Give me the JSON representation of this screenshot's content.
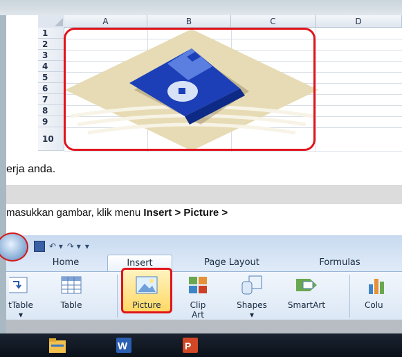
{
  "sheet": {
    "columns": [
      "A",
      "B",
      "C",
      "D"
    ],
    "rows": [
      "1",
      "2",
      "3",
      "4",
      "5",
      "6",
      "7",
      "8",
      "9",
      "10"
    ]
  },
  "text_line1": "erja anda.",
  "text_line2": {
    "prefix": "masukkan gambar, klik menu ",
    "bold1": "Insert",
    "mid": " > ",
    "bold2": "Picture",
    "suffix": " >"
  },
  "ribbon": {
    "tabs": [
      "Home",
      "Insert",
      "Page Layout",
      "Formulas"
    ],
    "active_tab": "Insert",
    "buttons": {
      "pivot": "tTable",
      "table": "Table",
      "picture": "Picture",
      "clipart_line1": "Clip",
      "clipart_line2": "Art",
      "shapes": "Shapes",
      "smartart": "SmartArt",
      "column": "Colu"
    }
  },
  "taskbar": {
    "icons": [
      "file-explorer-icon",
      "word-icon",
      "powerpoint-icon"
    ]
  },
  "colors": {
    "highlight_red": "#e1141c",
    "floppy_blue": "#1c3fb8",
    "diamond_beige": "#e6dbb4"
  }
}
